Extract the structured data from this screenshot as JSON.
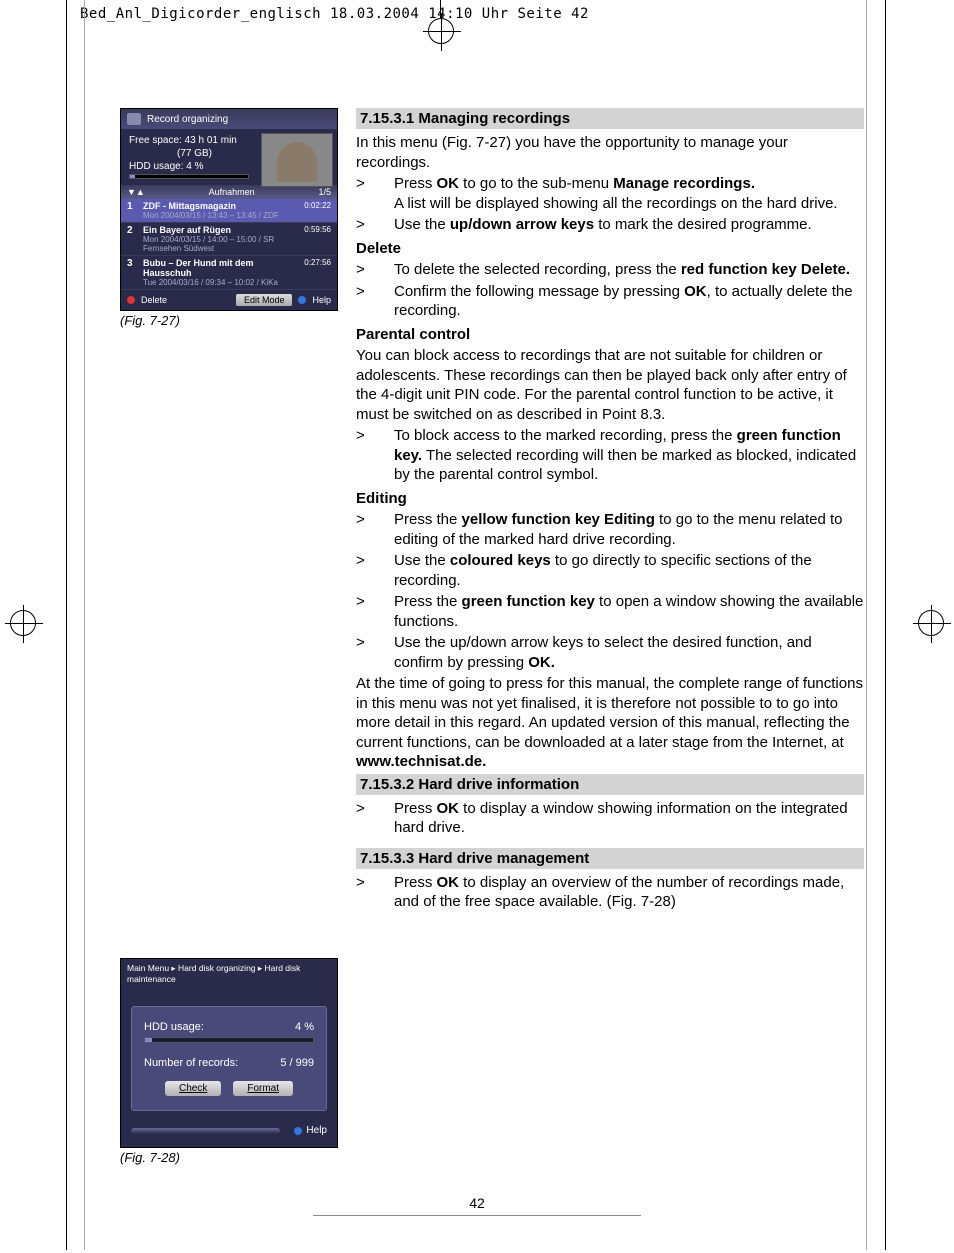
{
  "header_line": "Bed_Anl_Digicorder_englisch  18.03.2004  14:10 Uhr  Seite 42",
  "page_number": "42",
  "fig27": {
    "panel_title": "Record organizing",
    "free_space_label": "Free space:",
    "free_space_value": "43 h 01 min",
    "free_space_sub": "(77 GB)",
    "hdd_usage_label": "HDD usage:",
    "hdd_usage_value": "4 %",
    "list_header": "Aufnahmen",
    "list_count": "1/5",
    "rows": [
      {
        "n": "1",
        "title": "ZDF - Mittagsmagazin",
        "meta": "Mon 2004/03/15 / 13:43 – 13:45 / ZDF",
        "dur": "0:02:22"
      },
      {
        "n": "2",
        "title": "Ein Bayer auf Rügen",
        "meta": "Mon 2004/03/15 / 14:00 – 15:00 / SR Fernsehen Südwest",
        "dur": "0:59:56"
      },
      {
        "n": "3",
        "title": "Bubu – Der Hund mit dem Hausschuh",
        "meta": "Tue 2004/03/16 / 09:34 – 10:02 / KiKa",
        "dur": "0:27:56"
      }
    ],
    "btn_delete": "Delete",
    "btn_edit": "Edit Mode",
    "btn_help": "Help",
    "caption": "(Fig. 7-27)"
  },
  "fig28": {
    "crumb": "Main Menu ▸ Hard disk organizing ▸ Hard disk maintenance",
    "hdd_usage_label": "HDD usage:",
    "hdd_usage_value": "4 %",
    "records_label": "Number of records:",
    "records_value": "5 / 999",
    "btn_check": "Check",
    "btn_format": "Format",
    "btn_help": "Help",
    "caption": "(Fig. 7-28)"
  },
  "sections": {
    "s1": {
      "title": "7.15.3.1 Managing recordings",
      "intro": "In this menu (Fig. 7-27) you have the opportunity to manage your recordings.",
      "b1a": "Press ",
      "b1b": "OK",
      "b1c": " to go to the sub-menu ",
      "b1d": "Manage recordings.",
      "b1e": "A list will be displayed showing all the recordings on the hard drive.",
      "b2a": "Use the ",
      "b2b": "up/down arrow keys",
      "b2c": " to mark the desired programme.",
      "delete_h": "Delete",
      "d1a": "To delete the selected recording, press the ",
      "d1b": "red function key Delete.",
      "d2a": "Confirm the following message by pressing  ",
      "d2b": "OK",
      "d2c": ", to actually delete the recording.",
      "parental_h": "Parental control",
      "parental_p": "You can block access to recordings that are not suitable for children or adolescents. These recordings can then be played back only after entry of the 4-digit unit PIN code. For the parental control function to be active, it must be switched on as described in Point 8.3.",
      "p1a": "To block access to the marked recording, press the ",
      "p1b": "green function key.",
      "p1c": " The selected recording will then be marked as blocked, indicated by the parental control symbol.",
      "edit_h": "Editing",
      "e1a": "Press the ",
      "e1b": "yellow function key Editing",
      "e1c": " to go to the menu related to editing of the marked hard drive recording.",
      "e2a": "Use the ",
      "e2b": "coloured keys",
      "e2c": " to go directly to specific sections of the recording.",
      "e3a": "Press the ",
      "e3b": "green function key",
      "e3c": " to open a window showing the available functions.",
      "e4a": "Use the up/down arrow keys to select the desired function, and confirm by pressing ",
      "e4b": "OK.",
      "outro": "At the time of going to press for this manual, the complete range of functions in this menu was not yet finalised, it is therefore not possible to to go into more detail in this regard. An updated version of this manual, reflecting the current functions, can be downloaded at a later stage from the Internet, at ",
      "outro_b": "www.technisat.de."
    },
    "s2": {
      "title": "7.15.3.2 Hard drive information",
      "b1a": "Press ",
      "b1b": "OK",
      "b1c": " to display a window showing information on the integrated hard drive."
    },
    "s3": {
      "title": "7.15.3.3 Hard drive management",
      "b1a": "Press ",
      "b1b": "OK",
      "b1c": " to display an overview of the number of recordings made, and of the free space available. (Fig. 7-28)"
    }
  }
}
